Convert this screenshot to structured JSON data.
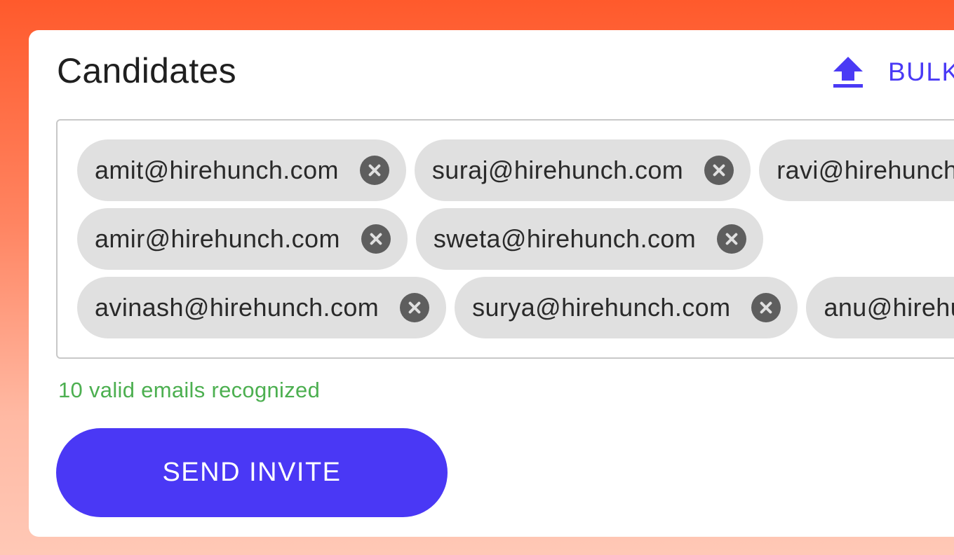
{
  "header": {
    "title": "Candidates",
    "bulk_label": "BULK",
    "bulk_icon": "upload-icon",
    "accent_color": "#4a3af5"
  },
  "chips": {
    "rows": [
      [
        "amit@hirehunch.com",
        "suraj@hirehunch.com",
        "ravi@hirehunch.com"
      ],
      [
        "amir@hirehunch.com",
        "sweta@hirehunch.com"
      ],
      [
        "avinash@hirehunch.com",
        "surya@hirehunch.com",
        "anu@hirehunch.com"
      ]
    ],
    "remove_icon": "close-circle-icon"
  },
  "status": {
    "text": "10 valid emails recognized",
    "color": "#4caf50"
  },
  "actions": {
    "send_label": "SEND INVITE",
    "send_color": "#4a38f5"
  }
}
